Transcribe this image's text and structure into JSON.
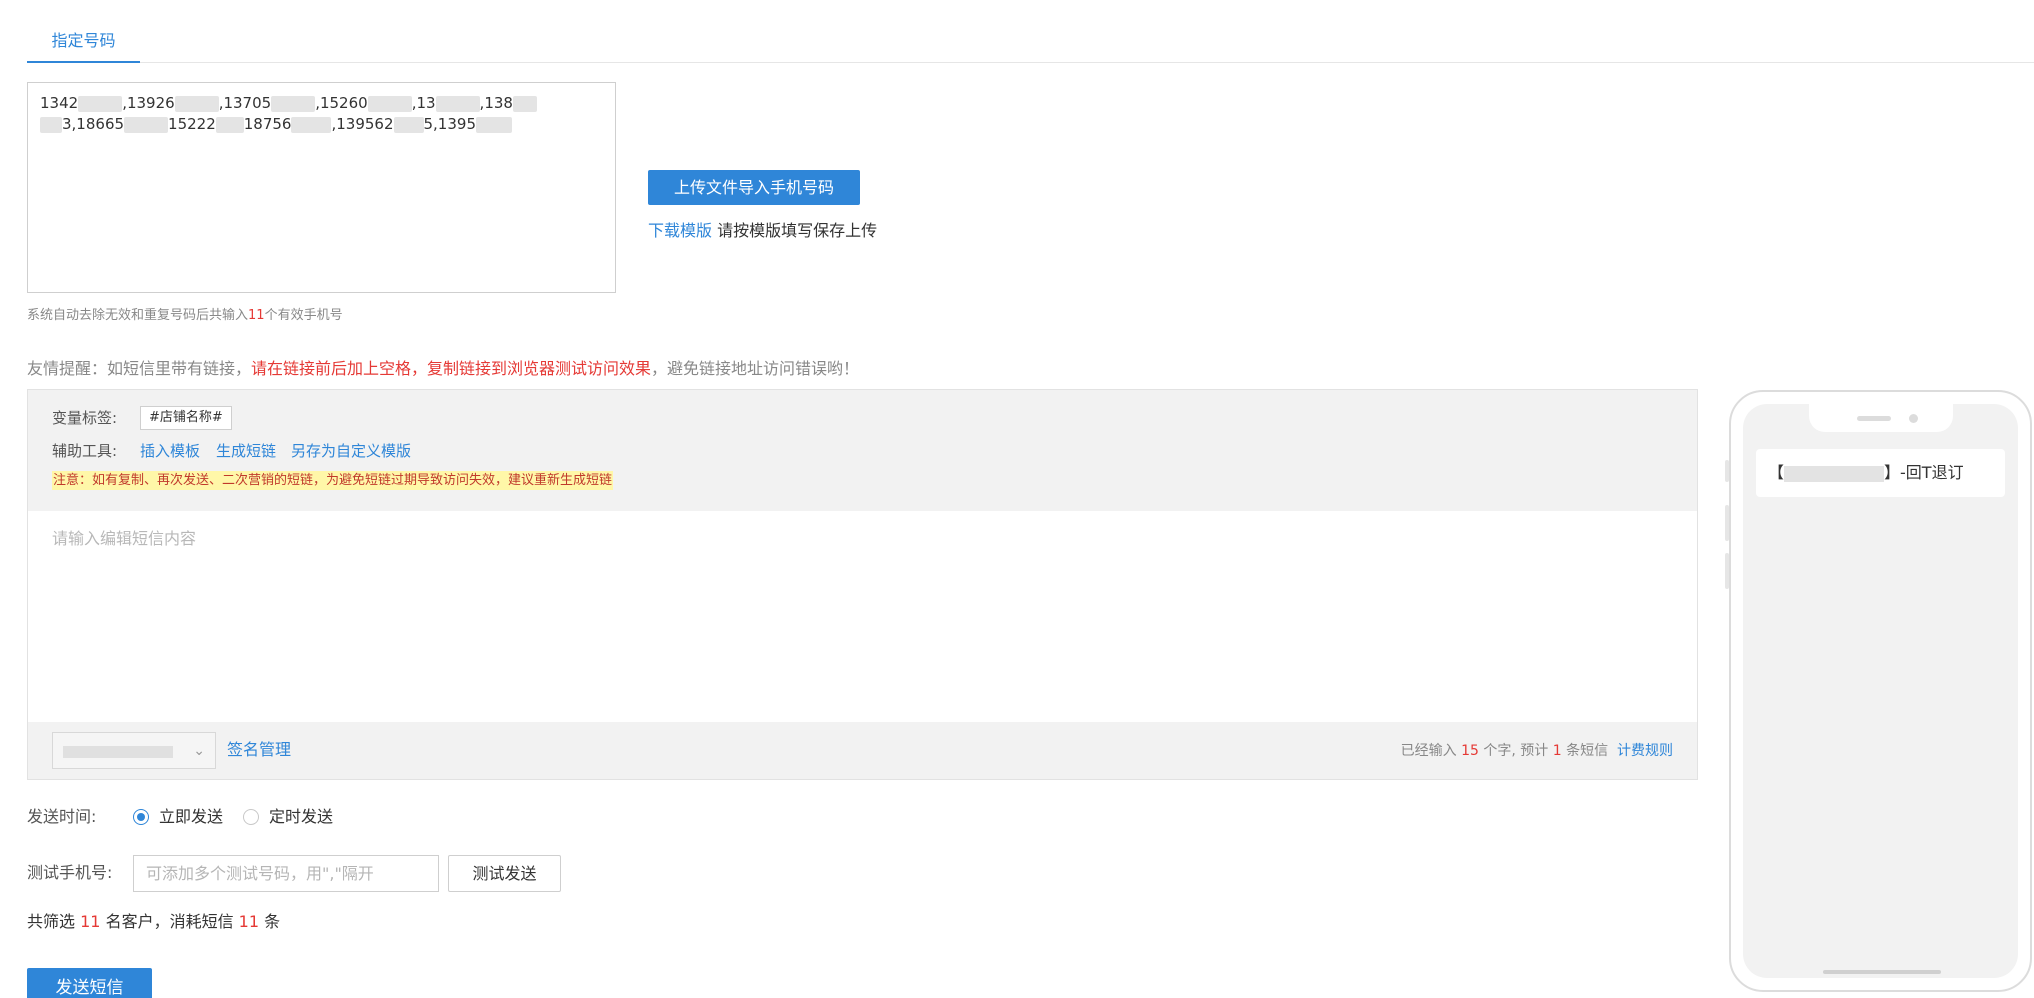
{
  "tabs": [
    {
      "label": "指定号码",
      "active": true
    }
  ],
  "numbers": {
    "value_parts": [
      "1342",
      ",13926",
      ",13705",
      ",15260",
      ",13",
      ",138",
      "3,18665",
      "15222",
      "18756",
      ",139562",
      "5,1395"
    ]
  },
  "upload": {
    "button_label": "上传文件导入手机号码",
    "download_link": "下载模版",
    "download_hint": "请按模版填写保存上传"
  },
  "valid_note": {
    "prefix": "系统自动去除无效和重复号码后共输入",
    "count": "11",
    "suffix": "个有效手机号"
  },
  "tip": {
    "prefix": "友情提醒：如短信里带有链接，",
    "highlight": "请在链接前后加上空格，复制链接到浏览器测试访问效果",
    "suffix": "，避免链接地址访问错误哟！"
  },
  "editor": {
    "var_label": "变量标签:",
    "var_tag": "#店铺名称#",
    "tools_label": "辅助工具:",
    "tools": [
      "插入模板",
      "生成短链",
      "另存为自定义模版"
    ],
    "warning": "注意：如有复制、再次发送、二次营销的短链，为避免短链过期导致访问失效，建议重新生成短链",
    "placeholder": "请输入编辑短信内容",
    "signature_manage": "签名管理",
    "count_prefix": "已经输入",
    "count_chars": "15",
    "count_mid": "个字, 预计",
    "count_sms": "1",
    "count_suffix": "条短信",
    "billing_rule": "计费规则"
  },
  "send_time": {
    "label": "发送时间:",
    "options": [
      {
        "label": "立即发送",
        "selected": true
      },
      {
        "label": "定时发送",
        "selected": false
      }
    ]
  },
  "test": {
    "label": "测试手机号:",
    "placeholder": "可添加多个测试号码，用\",\"隔开",
    "button": "测试发送"
  },
  "summary": {
    "prefix": "共筛选",
    "customers": "11",
    "mid": "名客户，消耗短信",
    "sms": "11",
    "suffix": "条"
  },
  "send_button": "发送短信",
  "preview": {
    "bracket_open": "【",
    "bracket_close": "】",
    "text": "-回T退订"
  },
  "icons": {
    "chevron": "chevron-down-icon",
    "radio": "radio-icon"
  },
  "colors": {
    "accent": "#2f86d8",
    "danger": "#e53935",
    "warning_bg": "#fff7a8"
  }
}
